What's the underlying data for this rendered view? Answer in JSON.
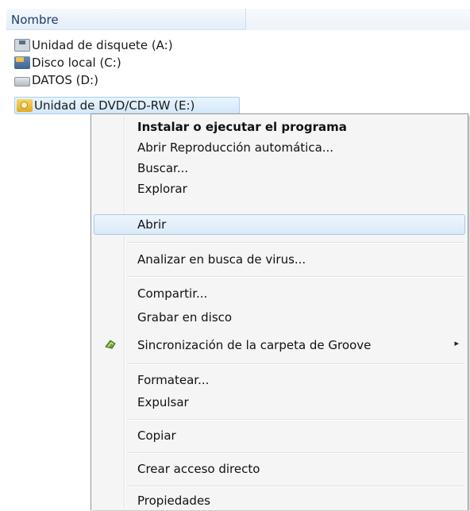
{
  "column_header": "Nombre",
  "drives": [
    {
      "label": "Unidad de disquete (A:)",
      "icon": "floppy-drive-icon"
    },
    {
      "label": "Disco local (C:)",
      "icon": "local-disk-icon"
    },
    {
      "label": "DATOS (D:)",
      "icon": "hard-drive-icon"
    },
    {
      "label": "Unidad de DVD/CD-RW (E:)",
      "icon": "dvd-drive-icon"
    }
  ],
  "context_menu": {
    "items": [
      {
        "label": "Instalar o ejecutar el programa"
      },
      {
        "label": "Abrir Reproducción automática..."
      },
      {
        "label": "Buscar..."
      },
      {
        "label": "Explorar"
      },
      {
        "label": "Abrir"
      },
      {
        "label": "Analizar en busca de virus..."
      },
      {
        "label": "Compartir..."
      },
      {
        "label": "Grabar en disco"
      },
      {
        "label": "Sincronización de la carpeta de Groove",
        "icon": "groove-sync-icon",
        "submenu_arrow": "▸"
      },
      {
        "label": "Formatear..."
      },
      {
        "label": "Expulsar"
      },
      {
        "label": "Copiar"
      },
      {
        "label": "Crear acceso directo"
      },
      {
        "label": "Propiedades"
      }
    ]
  },
  "colors": {
    "highlight_border": "#a8c8ea",
    "menu_background": "#f5f5f5",
    "header_text": "#1e3d6b"
  }
}
